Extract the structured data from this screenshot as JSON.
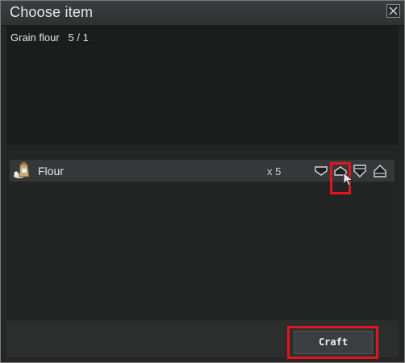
{
  "window": {
    "title": "Choose item"
  },
  "recipe": {
    "text": "Grain flour   5 / 1"
  },
  "items": [
    {
      "name": "Flour",
      "count": "x 5",
      "icon": "flour-sack-icon"
    }
  ],
  "quantity_controls": [
    {
      "icon": "decrease-one-icon"
    },
    {
      "icon": "increase-one-icon"
    },
    {
      "icon": "decrease-all-icon"
    },
    {
      "icon": "increase-all-icon"
    }
  ],
  "footer": {
    "craft_label": "Craft"
  },
  "colors": {
    "highlight": "#e5141c",
    "row": "#353839",
    "panel": "#1b1c1c"
  }
}
